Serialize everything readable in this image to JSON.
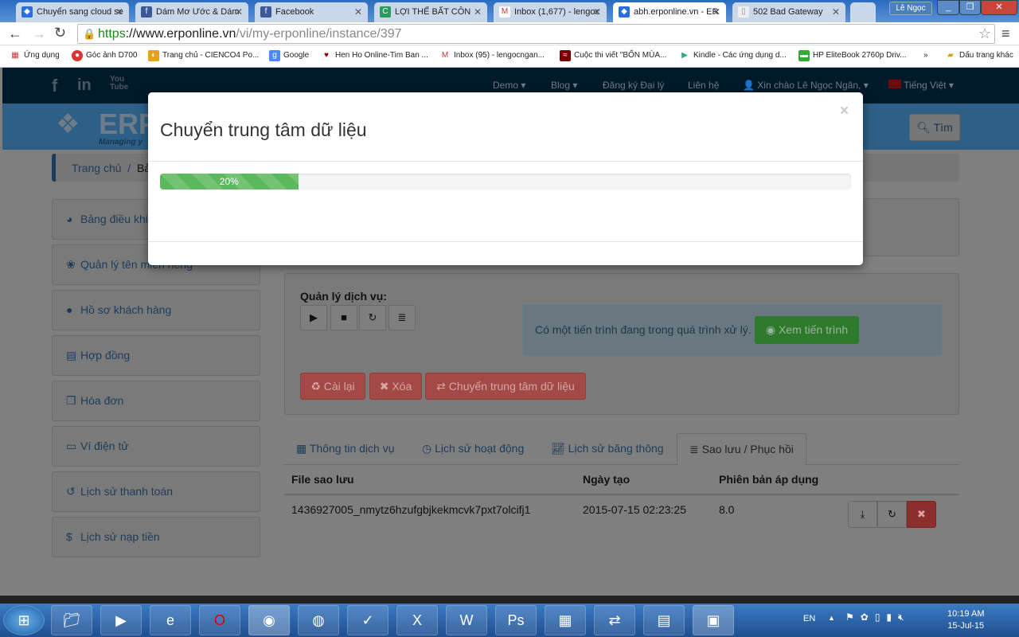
{
  "browser": {
    "tabs": [
      {
        "title": "Chuyển sang cloud se",
        "icon": "erp-icon"
      },
      {
        "title": "Dám Mơ Ước & Dám",
        "icon": "facebook-icon"
      },
      {
        "title": "Facebook",
        "icon": "facebook-icon"
      },
      {
        "title": "LỢI THẾ BẤT CÔN",
        "icon": "site-icon"
      },
      {
        "title": "Inbox (1,677) - lengoc",
        "icon": "gmail-icon"
      },
      {
        "title": "abh.erponline.vn - ER",
        "icon": "erp-icon",
        "active": true
      },
      {
        "title": "502 Bad Gateway",
        "icon": "page-icon"
      }
    ],
    "profile": "Lê Ngọc",
    "url": {
      "scheme": "https",
      "host": "://www.erponline.vn",
      "path": "/vi/my-erponline/instance/397"
    },
    "bookmarks": [
      "Ứng dụng",
      "Góc ảnh D700",
      "Trang chủ - CIENCO4 Po...",
      "Google",
      "Hen Ho Online-Tim Ban ...",
      "Inbox (95) - lengocngan...",
      "Cuộc thi viết \"BỐN MÙA...",
      "Kindle - Các ứng dụng d...",
      "HP EliteBook 2760p Driv..."
    ],
    "more": "»",
    "other_bookmarks": "Dấu trang khác"
  },
  "site": {
    "nav": [
      "Demo ▾",
      "Blog ▾",
      "Đăng ký Đại lý",
      "Liên hệ",
      "Xin chào Lê Ngọc Ngân, ▾",
      "Tiếng Việt ▾"
    ],
    "logo": "ERP",
    "tagline": "Managing y",
    "search": "Tìm",
    "breadcrumb": {
      "home": "Trang chủ",
      "sep": "/",
      "current": "Bả"
    },
    "sidebar": [
      {
        "label": "Bảng điều khiển",
        "icon": "dashboard-icon"
      },
      {
        "label": "Quản lý tên miền riêng",
        "icon": "paw-icon"
      },
      {
        "label": "Hồ sơ khách hàng",
        "icon": "user-icon"
      },
      {
        "label": "Hợp đồng",
        "icon": "file-icon"
      },
      {
        "label": "Hóa đơn",
        "icon": "copy-icon"
      },
      {
        "label": "Ví điện tử",
        "icon": "credit-card-icon"
      },
      {
        "label": "Lịch sử thanh toán",
        "icon": "history-icon"
      },
      {
        "label": "Lịch sử nạp tiền",
        "icon": "dollar-icon"
      }
    ],
    "service_label": "Quản lý dịch vụ:",
    "alert": "Có một tiến trình đang trong quá trình xử lý.",
    "view_progress": "Xem tiến trình",
    "buttons": {
      "reinstall": "Cài lại",
      "delete": "Xóa",
      "migrate": "Chuyển trung tâm dữ liệu"
    },
    "tabs": [
      "Thông tin dịch vụ",
      "Lịch sử hoạt động",
      "Lịch sử băng thông",
      "Sao lưu / Phục hồi"
    ],
    "table": {
      "headers": [
        "File sao lưu",
        "Ngày tạo",
        "Phiên bản áp dụng"
      ],
      "rows": [
        {
          "file": "1436927005_nmytz6hzufgbjkekmcvk7pxt7olcifj1",
          "date": "2015-07-15 02:23:25",
          "version": "8.0"
        }
      ]
    }
  },
  "modal": {
    "title": "Chuyển trung tâm dữ liệu",
    "close": "×",
    "progress": 20,
    "progress_label": "20%"
  },
  "taskbar": {
    "lang": "EN",
    "time": "10:19 AM",
    "date": "15-Jul-15"
  }
}
